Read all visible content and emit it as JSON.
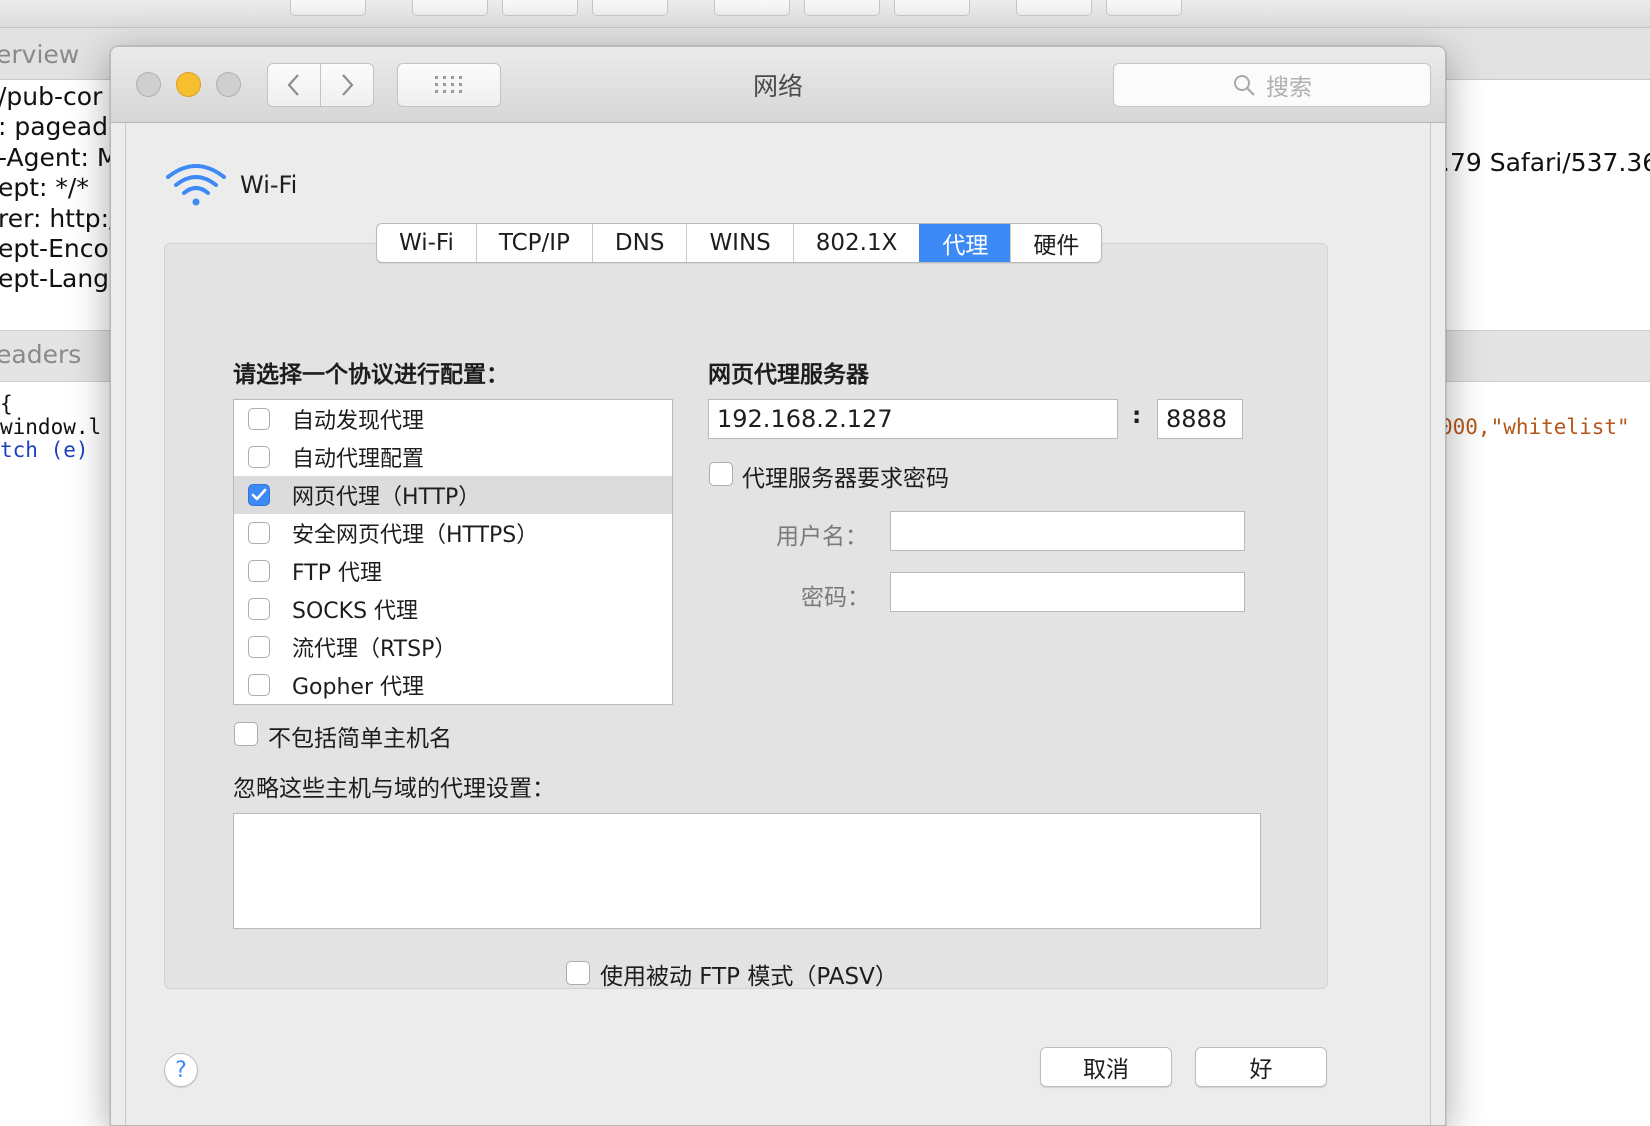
{
  "background": {
    "tab_label": "erview",
    "header_lines": [
      "/pub-cor",
      ": pagead",
      "-Agent: M",
      "ept: */*",
      "rer: http:/",
      "ept-Encoc",
      "ept-Langu"
    ],
    "right_text": ".79 Safari/537.36",
    "section_label": "eaders",
    "code_lines": [
      "{",
      "window.l",
      "tch (e)"
    ],
    "code_right": {
      "num": "000,",
      "str": "\"whitelist\""
    }
  },
  "window": {
    "title": "网络",
    "search_placeholder": "搜索"
  },
  "interface": {
    "name": "Wi-Fi"
  },
  "tabs": [
    {
      "label": "Wi-Fi",
      "active": false
    },
    {
      "label": "TCP/IP",
      "active": false
    },
    {
      "label": "DNS",
      "active": false
    },
    {
      "label": "WINS",
      "active": false
    },
    {
      "label": "802.1X",
      "active": false
    },
    {
      "label": "代理",
      "active": true
    },
    {
      "label": "硬件",
      "active": false
    }
  ],
  "protocols": {
    "heading": "请选择一个协议进行配置：",
    "items": [
      {
        "label": "自动发现代理",
        "checked": false,
        "selected": false
      },
      {
        "label": "自动代理配置",
        "checked": false,
        "selected": false
      },
      {
        "label": "网页代理（HTTP）",
        "checked": true,
        "selected": true
      },
      {
        "label": "安全网页代理（HTTPS）",
        "checked": false,
        "selected": false
      },
      {
        "label": "FTP 代理",
        "checked": false,
        "selected": false
      },
      {
        "label": "SOCKS 代理",
        "checked": false,
        "selected": false
      },
      {
        "label": "流代理（RTSP）",
        "checked": false,
        "selected": false
      },
      {
        "label": "Gopher 代理",
        "checked": false,
        "selected": false
      }
    ]
  },
  "proxy": {
    "heading": "网页代理服务器",
    "server": "192.168.2.127",
    "separator": ":",
    "port": "8888",
    "requires_password_label": "代理服务器要求密码",
    "requires_password": false,
    "username_label": "用户名：",
    "username": "",
    "password_label": "密码：",
    "password": ""
  },
  "exclude_simple_hostnames": {
    "label": "不包括简单主机名",
    "checked": false
  },
  "bypass": {
    "label": "忽略这些主机与域的代理设置：",
    "value": ""
  },
  "passive_ftp": {
    "label": "使用被动 FTP 模式（PASV）",
    "checked": false
  },
  "buttons": {
    "help": "?",
    "cancel": "取消",
    "ok": "好"
  },
  "colors": {
    "accent": "#3d8af7",
    "minimize": "#f7be2f"
  }
}
